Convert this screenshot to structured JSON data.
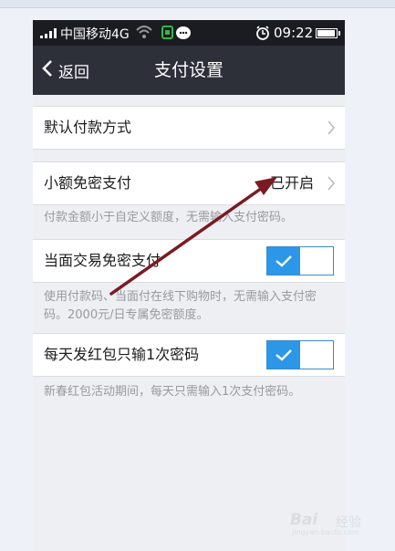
{
  "status_bar": {
    "carrier": "中国移动4G",
    "time": "09:22"
  },
  "nav": {
    "back_label": "返回",
    "title": "支付设置"
  },
  "settings": {
    "default_payment": {
      "label": "默认付款方式"
    },
    "small_amount": {
      "label": "小额免密支付",
      "status": "已开启",
      "description": "付款金额小于自定义额度，无需输入支付密码。"
    },
    "face_to_face": {
      "label": "当面交易免密支付",
      "enabled": true,
      "description": "使用付款码、当面付在线下购物时，无需输入支付密码。2000元/日专属免密额度。"
    },
    "red_packet": {
      "label": "每天发红包只输1次密码",
      "enabled": true,
      "description": "新春红包活动期间，每天只需输入1次支付密码。"
    }
  },
  "watermark": {
    "brand": "Bai",
    "brand_suffix": "经验",
    "url": "jingyan.baidu.com"
  },
  "colors": {
    "toggle_on": "#2c97e6",
    "nav_bg": "#2d2f39",
    "annotation_arrow": "#7a1a22"
  }
}
